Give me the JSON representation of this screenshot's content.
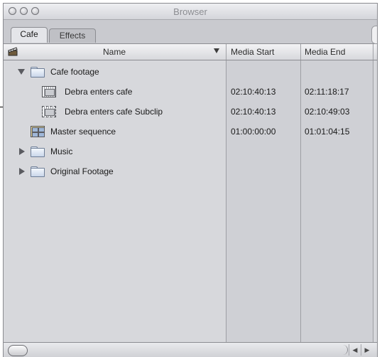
{
  "window": {
    "title": "Browser"
  },
  "tabs": [
    {
      "label": "Cafe",
      "active": true
    },
    {
      "label": "Effects",
      "active": false
    }
  ],
  "columns": {
    "name": "Name",
    "media_start": "Media Start",
    "media_end": "Media End"
  },
  "rows": [
    {
      "type": "folder",
      "expanded": true,
      "name": "Cafe footage",
      "media_start": "",
      "media_end": ""
    },
    {
      "type": "clip",
      "name": "Debra enters cafe",
      "media_start": "02:10:40:13",
      "media_end": "02:11:18:17"
    },
    {
      "type": "subclip",
      "name": "Debra enters cafe Subclip",
      "media_start": "02:10:40:13",
      "media_end": "02:10:49:03"
    },
    {
      "type": "sequence",
      "name": "Master sequence",
      "media_start": "01:00:00:00",
      "media_end": "01:01:04:15"
    },
    {
      "type": "folder",
      "expanded": false,
      "name": "Music",
      "media_start": "",
      "media_end": ""
    },
    {
      "type": "folder",
      "expanded": false,
      "name": "Original Footage",
      "media_start": "",
      "media_end": ""
    }
  ],
  "icons": {
    "close": "close-button-icon",
    "minimize": "minimize-button-icon",
    "zoom": "zoom-button-icon",
    "clapper": "clapperboard-icon",
    "sort": "sort-descending-icon",
    "folder": "folder-icon",
    "clip": "clip-icon",
    "subclip": "subclip-icon",
    "sequence": "sequence-icon",
    "scroll_left": "scroll-left-arrow-icon",
    "scroll_right": "scroll-right-arrow-icon"
  },
  "colors": {
    "window_bg": "#d9dadf",
    "column_bg": "#cfd0d5",
    "folder_fill": "#c9d6ea"
  }
}
